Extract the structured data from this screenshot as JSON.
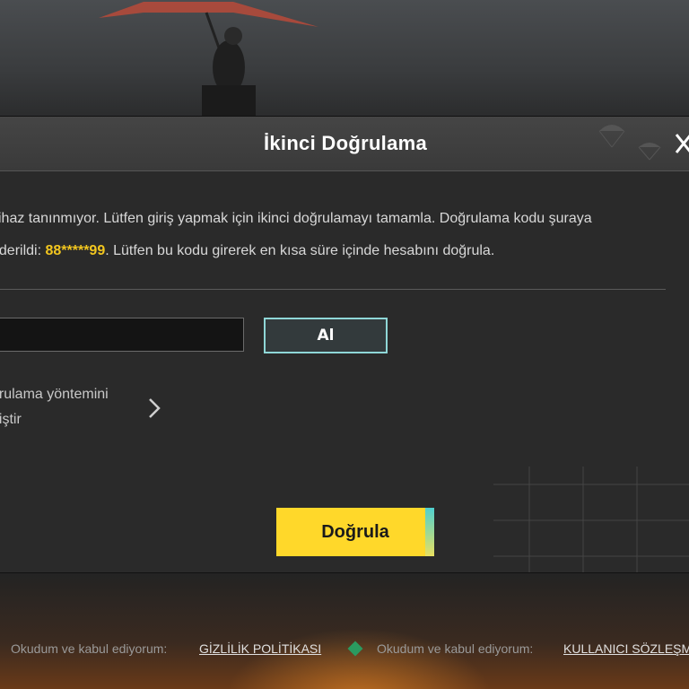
{
  "dialog": {
    "title": "İkinci Doğrulama",
    "message_line1": "cihaz tanınmıyor. Lütfen giriş yapmak için ikinci doğrulamayı tamamla. Doğrulama kodu şuraya",
    "message_line2_prefix": "nderildi: ",
    "masked_code": "88*****99",
    "message_line2_suffix": ". Lütfen bu kodu girerek en kısa süre içinde hesabını doğrula.",
    "code_input": {
      "value": "",
      "placeholder": ""
    },
    "get_code_label": "Al",
    "change_method_line1": "ğrulama yöntemini",
    "change_method_line2": "ğiştir",
    "verify_label": "Doğrula"
  },
  "footer": {
    "agree_text_1": "Okudum ve kabul ediyorum:",
    "privacy_link": "GİZLİLİK POLİTİKASI",
    "agree_text_2": "Okudum ve kabul ediyorum:",
    "terms_link": "KULLANICI SÖZLEŞM"
  },
  "icons": {
    "close": "close-icon",
    "chevron": "chevron-right-icon",
    "check": "diamond-check-icon"
  },
  "colors": {
    "accent_yellow": "#ffd82a",
    "code_highlight": "#f2c61f",
    "button_border": "#8fd7d7",
    "dialog_bg": "#2a2a2a"
  }
}
